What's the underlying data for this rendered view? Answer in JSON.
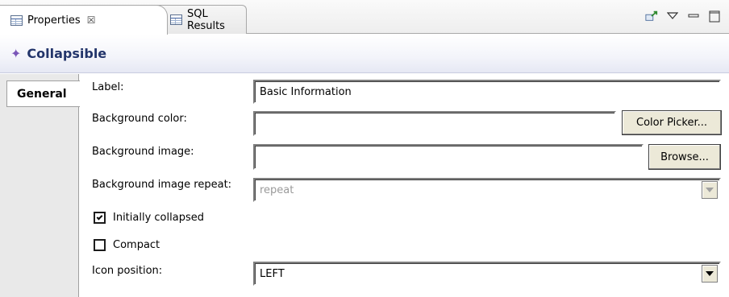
{
  "tabs": [
    {
      "label": "Properties",
      "close": "☒"
    },
    {
      "label": "SQL Results"
    }
  ],
  "title": "Collapsible",
  "sidebar": {
    "general_tab": "General"
  },
  "form": {
    "label": {
      "label": "Label:",
      "value": "Basic Information"
    },
    "background_color": {
      "label": "Background color:",
      "value": "",
      "button": "Color Picker..."
    },
    "background_image": {
      "label": "Background image:",
      "value": "",
      "button": "Browse..."
    },
    "background_image_repeat": {
      "label": "Background image repeat:",
      "value": "repeat"
    },
    "initially_collapsed": {
      "label": "Initially collapsed",
      "checked": true
    },
    "compact": {
      "label": "Compact",
      "checked": false
    },
    "icon_position": {
      "label": "Icon position:",
      "value": "LEFT"
    }
  },
  "colors": {
    "title_text": "#23356b",
    "title_icon": "#7a56b8"
  }
}
